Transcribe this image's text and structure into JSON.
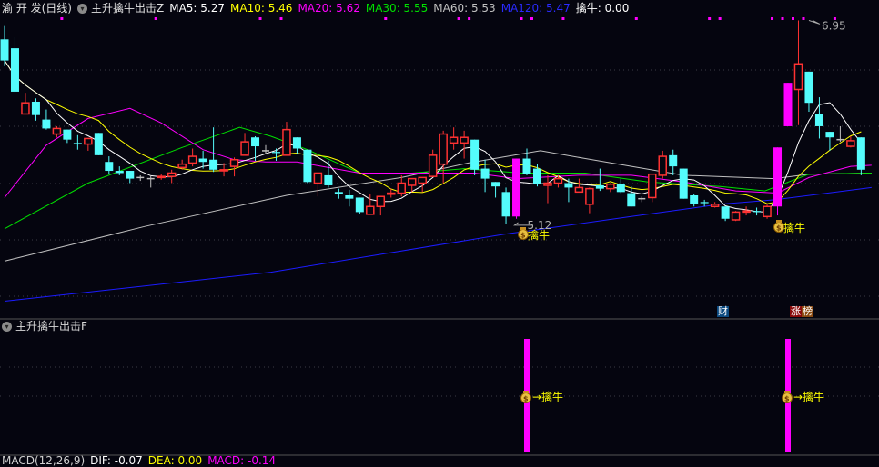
{
  "header": {
    "stock": "渝 开 发(日线)",
    "indicator": "主升擒牛出击Z",
    "ma5": "MA5: 5.27",
    "ma10": "MA10: 5.46",
    "ma20": "MA20: 5.62",
    "ma30": "MA30: 5.55",
    "ma60": "MA60: 5.53",
    "ma120": "MA120: 5.47",
    "qiniu": "擒牛: 0.00"
  },
  "sub_panel": {
    "title": "主升擒牛出击F",
    "signal_label": "→擒牛"
  },
  "macd_panel": {
    "title": "MACD(12,26,9)",
    "dif": "DIF: -0.07",
    "dea": "DEA: 0.00",
    "macd": "MACD: -0.14"
  },
  "tags": {
    "cai": "财",
    "zhang": "涨",
    "bang": "榜"
  },
  "colors": {
    "up": "#ff3232",
    "down": "#54fcfc",
    "signal": "#ff00ff",
    "ma5": "#ffffff",
    "ma10": "#ffff00",
    "ma20": "#ff00ff",
    "ma30": "#00e000",
    "ma60": "#c0c0c0",
    "ma120": "#1c1cff",
    "background": "#05050f"
  },
  "chart_data": {
    "type": "candlestick",
    "ylim": [
      4.32,
      6.97
    ],
    "annotations": {
      "low": "5.12",
      "low_index": 49,
      "high": "6.95",
      "high_index": 77,
      "signal_text": "擒牛",
      "signal_indices": [
        50,
        75
      ]
    },
    "top_markers": [
      5,
      14,
      24,
      26,
      36,
      43,
      44,
      49,
      50,
      53,
      60,
      67,
      68,
      73,
      74,
      75,
      76,
      79
    ],
    "ohlc": [
      [
        6.78,
        6.9,
        6.54,
        6.59
      ],
      [
        6.7,
        6.8,
        6.3,
        6.31
      ],
      [
        6.11,
        6.3,
        6.11,
        6.21
      ],
      [
        6.22,
        6.25,
        6.05,
        6.1
      ],
      [
        6.06,
        6.15,
        5.97,
        5.98
      ],
      [
        5.93,
        6.0,
        5.9,
        5.98
      ],
      [
        5.97,
        5.97,
        5.85,
        5.88
      ],
      [
        5.85,
        5.92,
        5.79,
        5.84
      ],
      [
        5.84,
        5.89,
        5.78,
        5.89
      ],
      [
        5.94,
        5.94,
        5.74,
        5.74
      ],
      [
        5.68,
        5.73,
        5.57,
        5.6
      ],
      [
        5.6,
        5.64,
        5.56,
        5.58
      ],
      [
        5.6,
        5.6,
        5.49,
        5.53
      ],
      [
        5.54,
        5.56,
        5.51,
        5.54
      ],
      [
        5.53,
        5.56,
        5.45,
        5.53
      ],
      [
        5.54,
        5.57,
        5.52,
        5.55
      ],
      [
        5.55,
        5.61,
        5.49,
        5.58
      ],
      [
        5.63,
        5.7,
        5.61,
        5.66
      ],
      [
        5.67,
        5.8,
        5.64,
        5.73
      ],
      [
        5.71,
        5.78,
        5.62,
        5.68
      ],
      [
        5.7,
        5.99,
        5.59,
        5.61
      ],
      [
        5.6,
        5.67,
        5.55,
        5.61
      ],
      [
        5.64,
        5.72,
        5.55,
        5.7
      ],
      [
        5.74,
        5.94,
        5.74,
        5.86
      ],
      [
        5.9,
        5.91,
        5.69,
        5.82
      ],
      [
        5.78,
        5.83,
        5.75,
        5.78
      ],
      [
        5.77,
        5.8,
        5.69,
        5.76
      ],
      [
        5.74,
        6.04,
        5.74,
        5.97
      ],
      [
        5.9,
        5.9,
        5.75,
        5.8
      ],
      [
        5.79,
        5.79,
        5.49,
        5.5
      ],
      [
        5.49,
        5.58,
        5.37,
        5.58
      ],
      [
        5.56,
        5.69,
        5.45,
        5.47
      ],
      [
        5.41,
        5.44,
        5.35,
        5.39
      ],
      [
        5.38,
        5.43,
        5.28,
        5.35
      ],
      [
        5.36,
        5.36,
        5.21,
        5.23
      ],
      [
        5.21,
        5.39,
        5.21,
        5.28
      ],
      [
        5.28,
        5.37,
        5.2,
        5.37
      ],
      [
        5.39,
        5.44,
        5.36,
        5.4
      ],
      [
        5.4,
        5.56,
        5.37,
        5.49
      ],
      [
        5.47,
        5.53,
        5.41,
        5.53
      ],
      [
        5.49,
        5.54,
        5.41,
        5.54
      ],
      [
        5.55,
        5.79,
        5.55,
        5.74
      ],
      [
        5.66,
        5.96,
        5.49,
        5.93
      ],
      [
        5.85,
        5.99,
        5.79,
        5.9
      ],
      [
        5.85,
        5.96,
        5.71,
        5.9
      ],
      [
        5.88,
        5.88,
        5.56,
        5.61
      ],
      [
        5.62,
        5.7,
        5.41,
        5.53
      ],
      [
        5.5,
        5.5,
        5.36,
        5.46
      ],
      [
        5.41,
        5.45,
        5.12,
        5.19
      ],
      [
        5.19,
        5.71,
        5.17,
        5.71
      ],
      [
        5.71,
        5.8,
        5.56,
        5.57
      ],
      [
        5.62,
        5.66,
        5.46,
        5.48
      ],
      [
        5.47,
        5.56,
        5.31,
        5.49
      ],
      [
        5.49,
        5.56,
        5.45,
        5.53
      ],
      [
        5.49,
        5.53,
        5.32,
        5.45
      ],
      [
        5.41,
        5.53,
        5.41,
        5.45
      ],
      [
        5.3,
        5.45,
        5.22,
        5.44
      ],
      [
        5.47,
        5.62,
        5.42,
        5.44
      ],
      [
        5.44,
        5.49,
        5.41,
        5.48
      ],
      [
        5.48,
        5.53,
        5.4,
        5.41
      ],
      [
        5.4,
        5.46,
        5.28,
        5.28
      ],
      [
        5.35,
        5.37,
        5.32,
        5.35
      ],
      [
        5.36,
        5.57,
        5.32,
        5.57
      ],
      [
        5.56,
        5.78,
        5.53,
        5.73
      ],
      [
        5.74,
        5.79,
        5.56,
        5.64
      ],
      [
        5.62,
        5.62,
        5.35,
        5.35
      ],
      [
        5.38,
        5.39,
        5.28,
        5.3
      ],
      [
        5.32,
        5.34,
        5.28,
        5.31
      ],
      [
        5.28,
        5.32,
        5.27,
        5.3
      ],
      [
        5.28,
        5.28,
        5.15,
        5.17
      ],
      [
        5.16,
        5.24,
        5.15,
        5.23
      ],
      [
        5.23,
        5.28,
        5.2,
        5.24
      ],
      [
        5.24,
        5.27,
        5.2,
        5.23
      ],
      [
        5.19,
        5.3,
        5.17,
        5.28
      ],
      [
        5.28,
        5.81,
        5.2,
        5.81
      ],
      [
        6.0,
        6.39,
        6.0,
        6.39
      ],
      [
        6.33,
        6.95,
        6.01,
        6.56
      ],
      [
        6.49,
        6.49,
        6.13,
        6.21
      ],
      [
        6.11,
        6.26,
        5.89,
        6.0
      ],
      [
        5.95,
        5.95,
        5.78,
        5.9
      ],
      [
        5.88,
        6.0,
        5.86,
        5.88
      ],
      [
        5.82,
        5.91,
        5.81,
        5.87
      ],
      [
        5.9,
        5.9,
        5.56,
        5.61
      ]
    ],
    "signal_candles": [
      49,
      74,
      75
    ],
    "ma_anchor_series": {
      "MA20": [
        [
          0,
          5.36
        ],
        [
          4,
          5.83
        ],
        [
          8,
          6.07
        ],
        [
          12,
          6.16
        ],
        [
          15,
          6.03
        ],
        [
          19,
          5.79
        ],
        [
          22,
          5.7
        ],
        [
          25,
          5.68
        ],
        [
          28,
          5.68
        ],
        [
          34,
          5.58
        ],
        [
          41,
          5.58
        ],
        [
          45,
          5.58
        ],
        [
          49,
          5.53
        ],
        [
          55,
          5.56
        ],
        [
          60,
          5.56
        ],
        [
          65,
          5.5
        ],
        [
          70,
          5.42
        ],
        [
          74,
          5.4
        ],
        [
          77,
          5.54
        ],
        [
          81,
          5.64
        ],
        [
          83,
          5.65
        ]
      ],
      "MA30": [
        [
          0,
          5.08
        ],
        [
          8,
          5.49
        ],
        [
          17,
          5.81
        ],
        [
          22.5,
          5.99
        ],
        [
          25.5,
          5.91
        ],
        [
          29,
          5.79
        ],
        [
          34,
          5.58
        ],
        [
          39,
          5.58
        ],
        [
          44,
          5.62
        ],
        [
          49.5,
          5.58
        ],
        [
          55.6,
          5.58
        ],
        [
          61.6,
          5.5
        ],
        [
          68.5,
          5.46
        ],
        [
          72.8,
          5.42
        ],
        [
          77,
          5.57
        ],
        [
          83,
          5.58
        ]
      ],
      "MA60": [
        [
          0,
          4.79
        ],
        [
          13.4,
          5.1
        ],
        [
          27,
          5.38
        ],
        [
          38,
          5.54
        ],
        [
          44.4,
          5.67
        ],
        [
          51.3,
          5.78
        ],
        [
          55.6,
          5.71
        ],
        [
          65,
          5.56
        ],
        [
          73.7,
          5.53
        ],
        [
          77,
          5.57
        ],
        [
          83,
          5.58
        ]
      ],
      "MA120": [
        [
          0,
          4.43
        ],
        [
          25.5,
          4.69
        ],
        [
          47.8,
          5.03
        ],
        [
          60,
          5.19
        ],
        [
          68.5,
          5.3
        ],
        [
          73.7,
          5.34
        ],
        [
          83,
          5.45
        ]
      ]
    }
  }
}
